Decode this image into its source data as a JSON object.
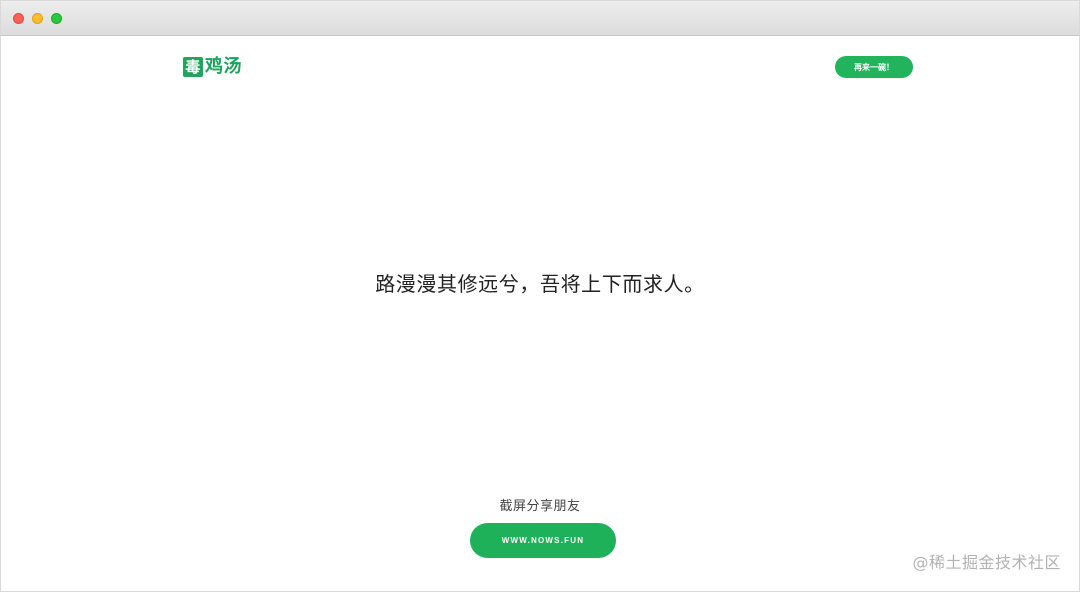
{
  "window": {
    "titlebar_buttons": [
      "close",
      "minimize",
      "zoom"
    ]
  },
  "header": {
    "logo_text": "毒鸡汤",
    "again_button_label": "再来一碗！"
  },
  "main": {
    "quote": "路漫漫其修远兮，吾将上下而求人。"
  },
  "footer": {
    "share_text": "截屏分享朋友",
    "url_button_label": "WWW.NOWS.FUN"
  },
  "watermark": {
    "text": "@稀土掘金技术社区"
  },
  "colors": {
    "accent": "#22b45c"
  }
}
